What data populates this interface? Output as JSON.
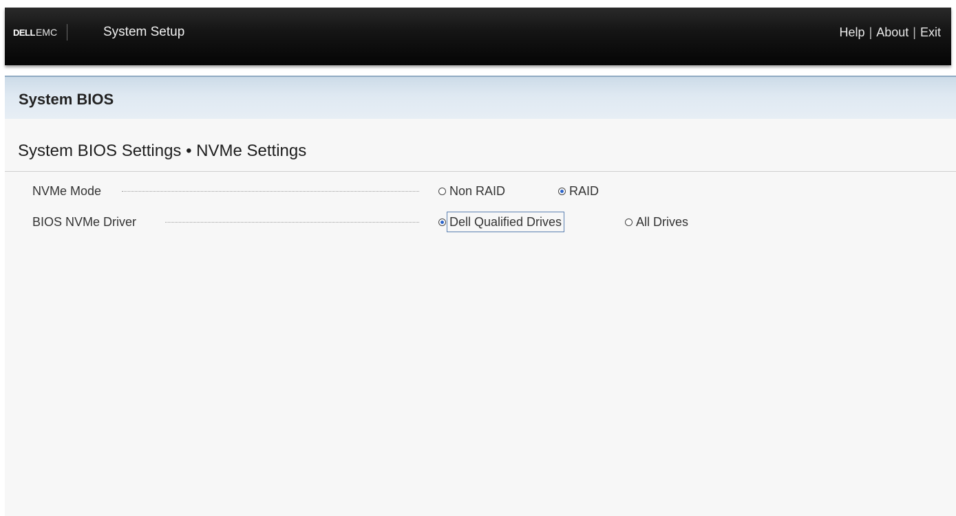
{
  "header": {
    "brand_dell": "DELL",
    "brand_emc": "EMC",
    "app_title": "System Setup",
    "links": {
      "help": "Help",
      "about": "About",
      "exit": "Exit",
      "separator": "|"
    }
  },
  "page": {
    "title": "System BIOS",
    "section_title": "System BIOS Settings • NVMe Settings"
  },
  "settings": [
    {
      "label": "NVMe Mode",
      "options": [
        {
          "label": "Non RAID",
          "selected": false
        },
        {
          "label": "RAID",
          "selected": true
        }
      ]
    },
    {
      "label": "BIOS NVMe Driver",
      "options": [
        {
          "label": "Dell Qualified Drives",
          "selected": true,
          "focused": true
        },
        {
          "label": "All Drives",
          "selected": false
        }
      ]
    }
  ],
  "colors": {
    "header_bg": "#0a0a0a",
    "page_header_bg": "#dfe9f2",
    "content_bg": "#f7f7f7",
    "radio_selected": "#2a63c9",
    "focus_border": "#5a7fb0"
  }
}
